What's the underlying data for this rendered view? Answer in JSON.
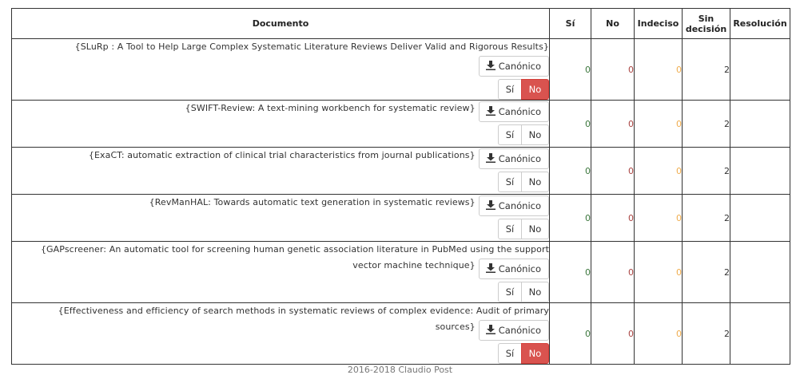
{
  "table": {
    "headers": {
      "documento": "Documento",
      "si": "Sí",
      "no": "No",
      "indeciso": "Indeciso",
      "sin_decision": "Sin decisión",
      "resolucion": "Resolución"
    },
    "labels": {
      "canonico": "Canónico",
      "si": "Sí",
      "no": "No"
    },
    "rows": [
      {
        "title": "{SLuRp : A Tool to Help Large Complex Systematic Literature Reviews Deliver Valid and Rigorous Results}",
        "si": "0",
        "no": "0",
        "indeciso": "0",
        "sin_decision": "2",
        "resolucion": "",
        "vote": "No"
      },
      {
        "title": "{SWIFT-Review: A text-mining workbench for systematic review}",
        "si": "0",
        "no": "0",
        "indeciso": "0",
        "sin_decision": "2",
        "resolucion": "",
        "vote": ""
      },
      {
        "title": "{ExaCT: automatic extraction of clinical trial characteristics from journal publications}",
        "si": "0",
        "no": "0",
        "indeciso": "0",
        "sin_decision": "2",
        "resolucion": "",
        "vote": ""
      },
      {
        "title": "{RevManHAL: Towards automatic text generation in systematic reviews}",
        "si": "0",
        "no": "0",
        "indeciso": "0",
        "sin_decision": "2",
        "resolucion": "",
        "vote": ""
      },
      {
        "title_line1": "{GAPscreener: An automatic tool for screening human genetic association literature in PubMed using the support",
        "title_line2": "vector machine technique}",
        "si": "0",
        "no": "0",
        "indeciso": "0",
        "sin_decision": "2",
        "resolucion": "",
        "vote": ""
      },
      {
        "title_line1": "{Effectiveness and efficiency of search methods in systematic reviews of complex evidence: Audit of primary",
        "title_line2": "sources}",
        "si": "0",
        "no": "0",
        "indeciso": "0",
        "sin_decision": "2",
        "resolucion": "",
        "vote": "No"
      }
    ]
  },
  "footer": {
    "text": "2016-2018 Claudio Post"
  },
  "icons": {
    "canonico": "download-icon"
  },
  "colors": {
    "si": "#3c763d",
    "no": "#a94442",
    "indeciso": "#f0ad4e",
    "no_active_bg": "#d9534f"
  }
}
